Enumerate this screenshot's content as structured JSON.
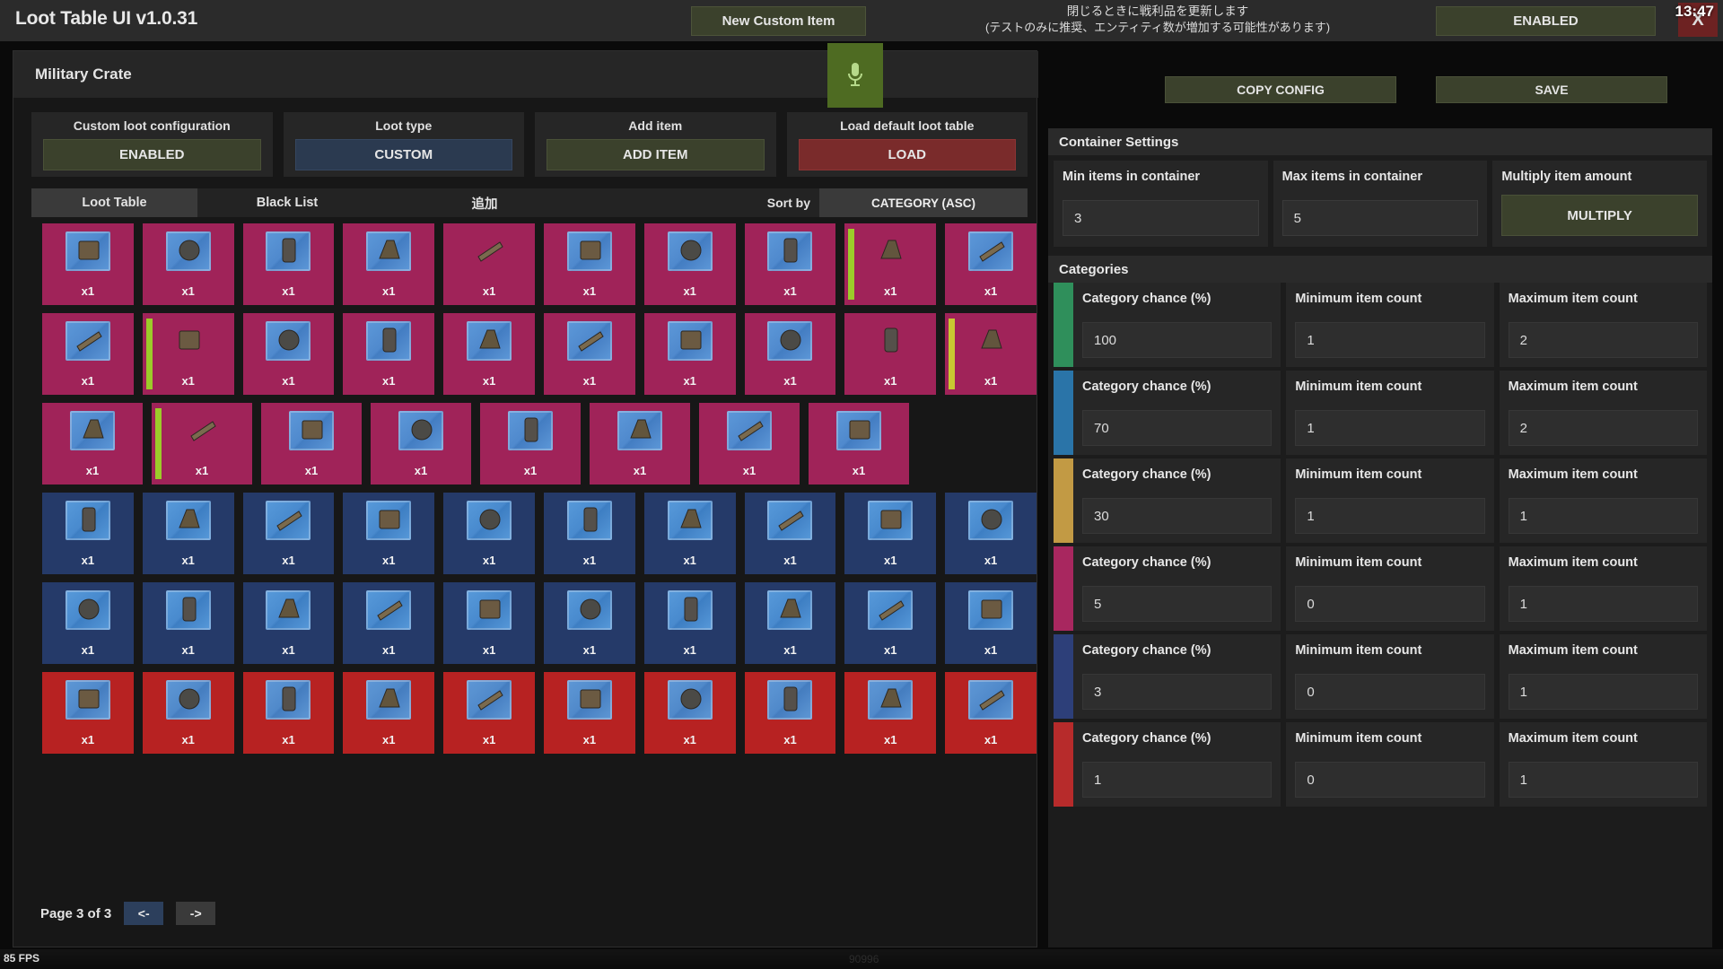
{
  "topbar": {
    "app_title": "Loot Table UI v1.0.31",
    "new_custom_item": "New Custom Item",
    "note_line1": "閉じるときに戦利品を更新します",
    "note_line2": "(テストのみに推奨、エンティティ数が増加する可能性があります)",
    "enabled_toggle": "ENABLED",
    "clock": "13:47",
    "close": "X"
  },
  "crate": {
    "title": "Military Crate",
    "copy_config": "COPY CONFIG",
    "save": "SAVE",
    "mic_icon": "microphone-icon"
  },
  "controls": [
    {
      "label": "Custom loot configuration",
      "value": "ENABLED",
      "style": "c-green"
    },
    {
      "label": "Loot type",
      "value": "CUSTOM",
      "style": "c-blue"
    },
    {
      "label": "Add item",
      "value": "ADD ITEM",
      "style": "c-green"
    },
    {
      "label": "Load default loot table",
      "value": "LOAD",
      "style": "c-red"
    }
  ],
  "tabs": [
    {
      "label": "Loot Table",
      "active": true
    },
    {
      "label": "Black List",
      "active": false
    },
    {
      "label": "追加",
      "active": false
    }
  ],
  "sort": {
    "label": "Sort by",
    "value": "CATEGORY (ASC)"
  },
  "pagination": {
    "text": "Page 3 of 3",
    "prev": "<-",
    "next": "->"
  },
  "container_settings": {
    "title": "Container Settings",
    "fields": [
      {
        "label": "Min items in container",
        "value": "3",
        "type": "input"
      },
      {
        "label": "Max items in container",
        "value": "5",
        "type": "input"
      },
      {
        "label": "Multiply item amount",
        "value": "MULTIPLY",
        "type": "button"
      }
    ]
  },
  "categories": {
    "title": "Categories",
    "col_labels": [
      "Category chance (%)",
      "Minimum item count",
      "Maximum item count"
    ],
    "rows": [
      {
        "color": "#2f8f5b",
        "chance": "100",
        "min": "1",
        "max": "2"
      },
      {
        "color": "#2a74a8",
        "chance": "70",
        "min": "1",
        "max": "2"
      },
      {
        "color": "#c29a44",
        "chance": "30",
        "min": "1",
        "max": "1"
      },
      {
        "color": "#a8275f",
        "chance": "5",
        "min": "0",
        "max": "1"
      },
      {
        "color": "#2d3f79",
        "chance": "3",
        "min": "0",
        "max": "1"
      },
      {
        "color": "#b72b2b",
        "chance": "1",
        "min": "0",
        "max": "1"
      }
    ]
  },
  "statusbar": {
    "fps": "85 FPS",
    "faint_number": "90996"
  },
  "grid": {
    "qty_label": "x1",
    "colors": {
      "magenta": "#a02359",
      "navy": "#253a69",
      "red": "#b72222"
    },
    "rows": [
      {
        "color": "magenta",
        "cells": [
          {
            "icon": "crate-shelf-icon",
            "stripe": null,
            "bp": true
          },
          {
            "icon": "electrical-box-icon",
            "stripe": null,
            "bp": true
          },
          {
            "icon": "control-panel-icon",
            "stripe": null,
            "bp": true
          },
          {
            "icon": "pickaxe-icon",
            "stripe": null,
            "bp": true
          },
          {
            "icon": "candle-icon",
            "stripe": null,
            "bp": false
          },
          {
            "icon": "cardboard-box-icon",
            "stripe": null,
            "bp": true
          },
          {
            "icon": "tool-icon",
            "stripe": null,
            "bp": true
          },
          {
            "icon": "jacket-icon",
            "stripe": null,
            "bp": true
          },
          {
            "icon": "locker-icon",
            "stripe": "green",
            "bp": false
          },
          {
            "icon": "green-door-icon",
            "stripe": null,
            "bp": true
          }
        ]
      },
      {
        "color": "magenta",
        "cells": [
          {
            "icon": "gas-mask-icon",
            "stripe": null,
            "bp": true
          },
          {
            "icon": "revolver-icon",
            "stripe": "green",
            "bp": false
          },
          {
            "icon": "supplies-icon",
            "stripe": null,
            "bp": true
          },
          {
            "icon": "red-hoodie-icon",
            "stripe": null,
            "bp": true
          },
          {
            "icon": "book-43-icon",
            "stripe": null,
            "bp": true
          },
          {
            "icon": "black-vest-icon",
            "stripe": null,
            "bp": true
          },
          {
            "icon": "green-ammo-box-icon",
            "stripe": null,
            "bp": true
          },
          {
            "icon": "wood-crate-icon",
            "stripe": null,
            "bp": true
          },
          {
            "icon": "shelf-rack-icon",
            "stripe": null,
            "bp": false
          },
          {
            "icon": "workbench-icon",
            "stripe": "yellow",
            "bp": false
          }
        ]
      },
      {
        "color": "magenta",
        "cells": [
          {
            "icon": "tire-icon",
            "stripe": null,
            "bp": true
          },
          {
            "icon": "rifle-icon",
            "stripe": "green",
            "bp": false
          },
          {
            "icon": "gloves-icon",
            "stripe": null,
            "bp": true
          },
          {
            "icon": "tarp-icon",
            "stripe": null,
            "bp": true
          },
          {
            "icon": "canteen-icon",
            "stripe": null,
            "bp": true
          },
          {
            "icon": "radio-icon",
            "stripe": null,
            "bp": true
          },
          {
            "icon": "plank-icon",
            "stripe": null,
            "bp": true
          },
          {
            "icon": "barrel-icon",
            "stripe": null,
            "bp": true
          }
        ]
      },
      {
        "color": "navy",
        "cells": [
          {
            "icon": "pistol-icon",
            "stripe": null,
            "bp": true
          },
          {
            "icon": "stove-icon",
            "stripe": null,
            "bp": true
          },
          {
            "icon": "rocket-icon",
            "stripe": null,
            "bp": true
          },
          {
            "icon": "suppressor-icon",
            "stripe": null,
            "bp": true
          },
          {
            "icon": "scope-icon",
            "stripe": null,
            "bp": true
          },
          {
            "icon": "flashlight-icon",
            "stripe": null,
            "bp": true
          },
          {
            "icon": "pot-icon",
            "stripe": null,
            "bp": true
          },
          {
            "icon": "generator-icon",
            "stripe": null,
            "bp": true
          },
          {
            "icon": "yellow-box-icon",
            "stripe": null,
            "bp": true
          },
          {
            "icon": "long-scope-icon",
            "stripe": null,
            "bp": true
          }
        ]
      },
      {
        "color": "navy",
        "cells": [
          {
            "icon": "hazmat-suit-icon",
            "stripe": null,
            "bp": true
          },
          {
            "icon": "lantern-icon",
            "stripe": null,
            "bp": true
          },
          {
            "icon": "grenade-icon",
            "stripe": null,
            "bp": true
          },
          {
            "icon": "metal-box-icon",
            "stripe": null,
            "bp": true
          },
          {
            "icon": "device-icon",
            "stripe": null,
            "bp": true
          },
          {
            "icon": "valve-icon",
            "stripe": null,
            "bp": true
          },
          {
            "icon": "crate-icon",
            "stripe": null,
            "bp": true
          },
          {
            "icon": "shotgun-icon",
            "stripe": null,
            "bp": true
          },
          {
            "icon": "smg-icon",
            "stripe": null,
            "bp": true
          },
          {
            "icon": "handgun-icon",
            "stripe": null,
            "bp": true
          }
        ]
      },
      {
        "color": "red",
        "cells": [
          {
            "icon": "magazine-icon",
            "stripe": null,
            "bp": true
          },
          {
            "icon": "turret-icon",
            "stripe": null,
            "bp": true
          },
          {
            "icon": "thompson-icon",
            "stripe": null,
            "bp": true
          },
          {
            "icon": "rocket-launcher-icon",
            "stripe": null,
            "bp": true
          },
          {
            "icon": "backpack-icon",
            "stripe": null,
            "bp": true
          },
          {
            "icon": "assault-rifle-icon",
            "stripe": null,
            "bp": true
          },
          {
            "icon": "smg2-icon",
            "stripe": null,
            "bp": true
          },
          {
            "icon": "sniper-icon",
            "stripe": null,
            "bp": true
          },
          {
            "icon": "lmg-icon",
            "stripe": null,
            "bp": true
          },
          {
            "icon": "ammo-crate-icon",
            "stripe": null,
            "bp": true
          }
        ]
      }
    ]
  }
}
